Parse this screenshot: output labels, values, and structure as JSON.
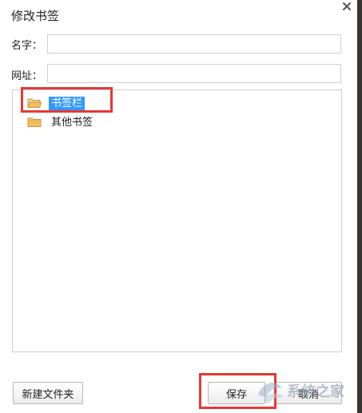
{
  "dialog": {
    "title": "修改书签",
    "name_label": "名字：",
    "name_value": "",
    "url_label": "网址：",
    "url_value": ""
  },
  "tree": {
    "items": [
      {
        "label": "书签栏",
        "selected": true
      },
      {
        "label": "其他书签",
        "selected": false
      }
    ]
  },
  "buttons": {
    "new_folder": "新建文件夹",
    "save": "保存",
    "cancel": "取消"
  },
  "watermark": {
    "text": "系统之家"
  },
  "colors": {
    "selection": "#3399ff",
    "highlight_box": "#e53935",
    "folder": "#f2c063"
  }
}
